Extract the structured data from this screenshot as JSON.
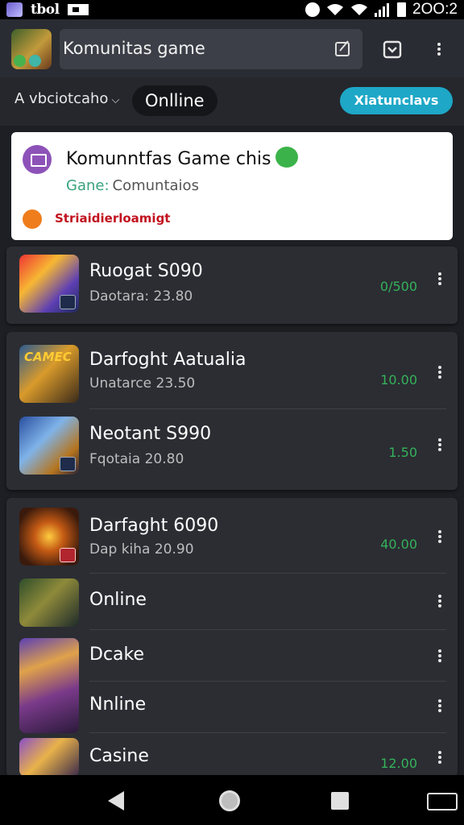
{
  "status_bar": {
    "carrier": "tbol",
    "time": "2OO:2"
  },
  "app_bar": {
    "search_text": "Komunitas game",
    "icons": [
      "edit-icon",
      "save-icon",
      "more-vert-icon"
    ]
  },
  "filter_bar": {
    "dropdown_label": "A vbciotcaho",
    "chip_label": "Onlline",
    "cta_label": "Xiatunclavs",
    "cta_color": "#1ea7c7"
  },
  "community_card": {
    "title": "Komunntfas Game chis",
    "sub_key": "Gane:",
    "sub_value": "Comuntaios",
    "alert": "Striaidierloamigt",
    "alert_color": "#c1121f"
  },
  "games": [
    {
      "name": "Ruogat S090",
      "meta": "Daotara: 23.80",
      "value": "0/500"
    },
    {
      "name": "Darfoght Aatualia",
      "meta": "Unatarce 23.50",
      "value": "10.00"
    },
    {
      "name": "Neotant S990",
      "meta": "Fqotaia 20.80",
      "value": "1.50"
    },
    {
      "name": "Darfaght 6090",
      "meta": "Dap kiha 20.90",
      "value": "40.00"
    },
    {
      "name": "Online",
      "meta": "",
      "value": ""
    },
    {
      "name": "Dcake",
      "meta": "",
      "value": ""
    },
    {
      "name": "Nnline",
      "meta": "",
      "value": ""
    },
    {
      "name": "Casine",
      "meta": "",
      "value": "12.00"
    }
  ],
  "thumb_label": "CAMEC",
  "value_color": "#35b25a"
}
